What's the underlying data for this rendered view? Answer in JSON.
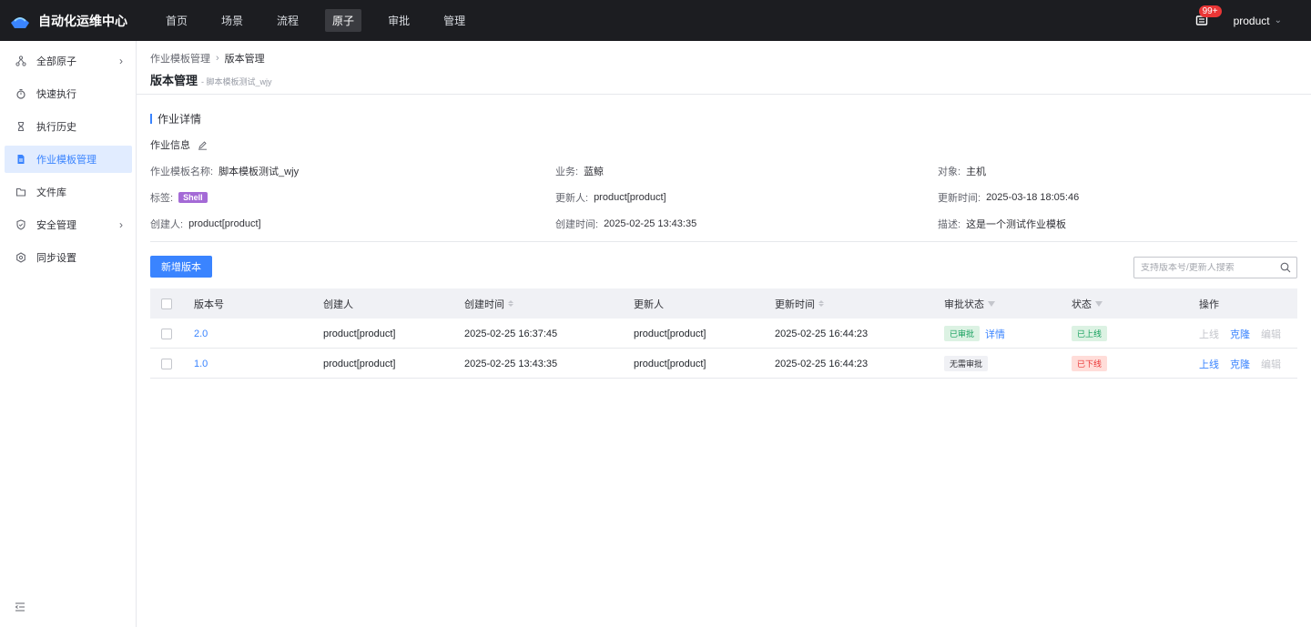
{
  "app": {
    "title": "自动化运维中心"
  },
  "nav": [
    {
      "label": "首页",
      "active": false
    },
    {
      "label": "场景",
      "active": false
    },
    {
      "label": "流程",
      "active": false
    },
    {
      "label": "原子",
      "active": true
    },
    {
      "label": "审批",
      "active": false
    },
    {
      "label": "管理",
      "active": false
    }
  ],
  "header": {
    "notification_count": "99+",
    "user": "product"
  },
  "sidebar": {
    "items": [
      {
        "label": "全部原子",
        "icon": "nodes-icon",
        "has_arrow": true
      },
      {
        "label": "快速执行",
        "icon": "stopwatch-icon",
        "has_arrow": false
      },
      {
        "label": "执行历史",
        "icon": "hourglass-icon",
        "has_arrow": false
      },
      {
        "label": "作业模板管理",
        "icon": "document-icon",
        "has_arrow": false,
        "active": true
      },
      {
        "label": "文件库",
        "icon": "folder-icon",
        "has_arrow": false
      },
      {
        "label": "安全管理",
        "icon": "shield-icon",
        "has_arrow": true
      },
      {
        "label": "同步设置",
        "icon": "gear-icon",
        "has_arrow": false
      }
    ]
  },
  "breadcrumb": {
    "parent": "作业模板管理",
    "current": "版本管理"
  },
  "page": {
    "title": "版本管理",
    "subtitle": "- 脚本模板测试_wjy"
  },
  "section": {
    "title": "作业详情",
    "info_label": "作业信息"
  },
  "fields": {
    "name": {
      "label": "作业模板名称:",
      "value": "脚本模板测试_wjy"
    },
    "business": {
      "label": "业务:",
      "value": "蓝鲸"
    },
    "object": {
      "label": "对象:",
      "value": "主机"
    },
    "tag": {
      "label": "标签:",
      "value": "Shell"
    },
    "updater": {
      "label": "更新人:",
      "value": "product[product]"
    },
    "update_time": {
      "label": "更新时间:",
      "value": "2025-03-18 18:05:46"
    },
    "creator": {
      "label": "创建人:",
      "value": "product[product]"
    },
    "create_time": {
      "label": "创建时间:",
      "value": "2025-02-25 13:43:35"
    },
    "description": {
      "label": "描述:",
      "value": "这是一个测试作业模板"
    }
  },
  "toolbar": {
    "add_label": "新增版本",
    "search_placeholder": "支持版本号/更新人搜索"
  },
  "table": {
    "columns": {
      "version": "版本号",
      "creator": "创建人",
      "create_time": "创建时间",
      "updater": "更新人",
      "update_time": "更新时间",
      "approval": "审批状态",
      "status": "状态",
      "actions": "操作"
    },
    "rows": [
      {
        "version": "2.0",
        "creator": "product[product]",
        "create_time": "2025-02-25 16:37:45",
        "updater": "product[product]",
        "update_time": "2025-02-25 16:44:23",
        "approval": "已审批",
        "approval_detail": "详情",
        "status": "已上线",
        "actions": [
          "上线",
          "克隆",
          "编辑"
        ]
      },
      {
        "version": "1.0",
        "creator": "product[product]",
        "create_time": "2025-02-25 13:43:35",
        "updater": "product[product]",
        "update_time": "2025-02-25 16:44:23",
        "approval": "无需审批",
        "status": "已下线",
        "actions": [
          "上线",
          "克隆",
          "编辑"
        ]
      }
    ]
  },
  "colors": {
    "accent": "#3a84ff",
    "topbar": "#1c1d21",
    "shell_tag": "#a46ad6"
  }
}
